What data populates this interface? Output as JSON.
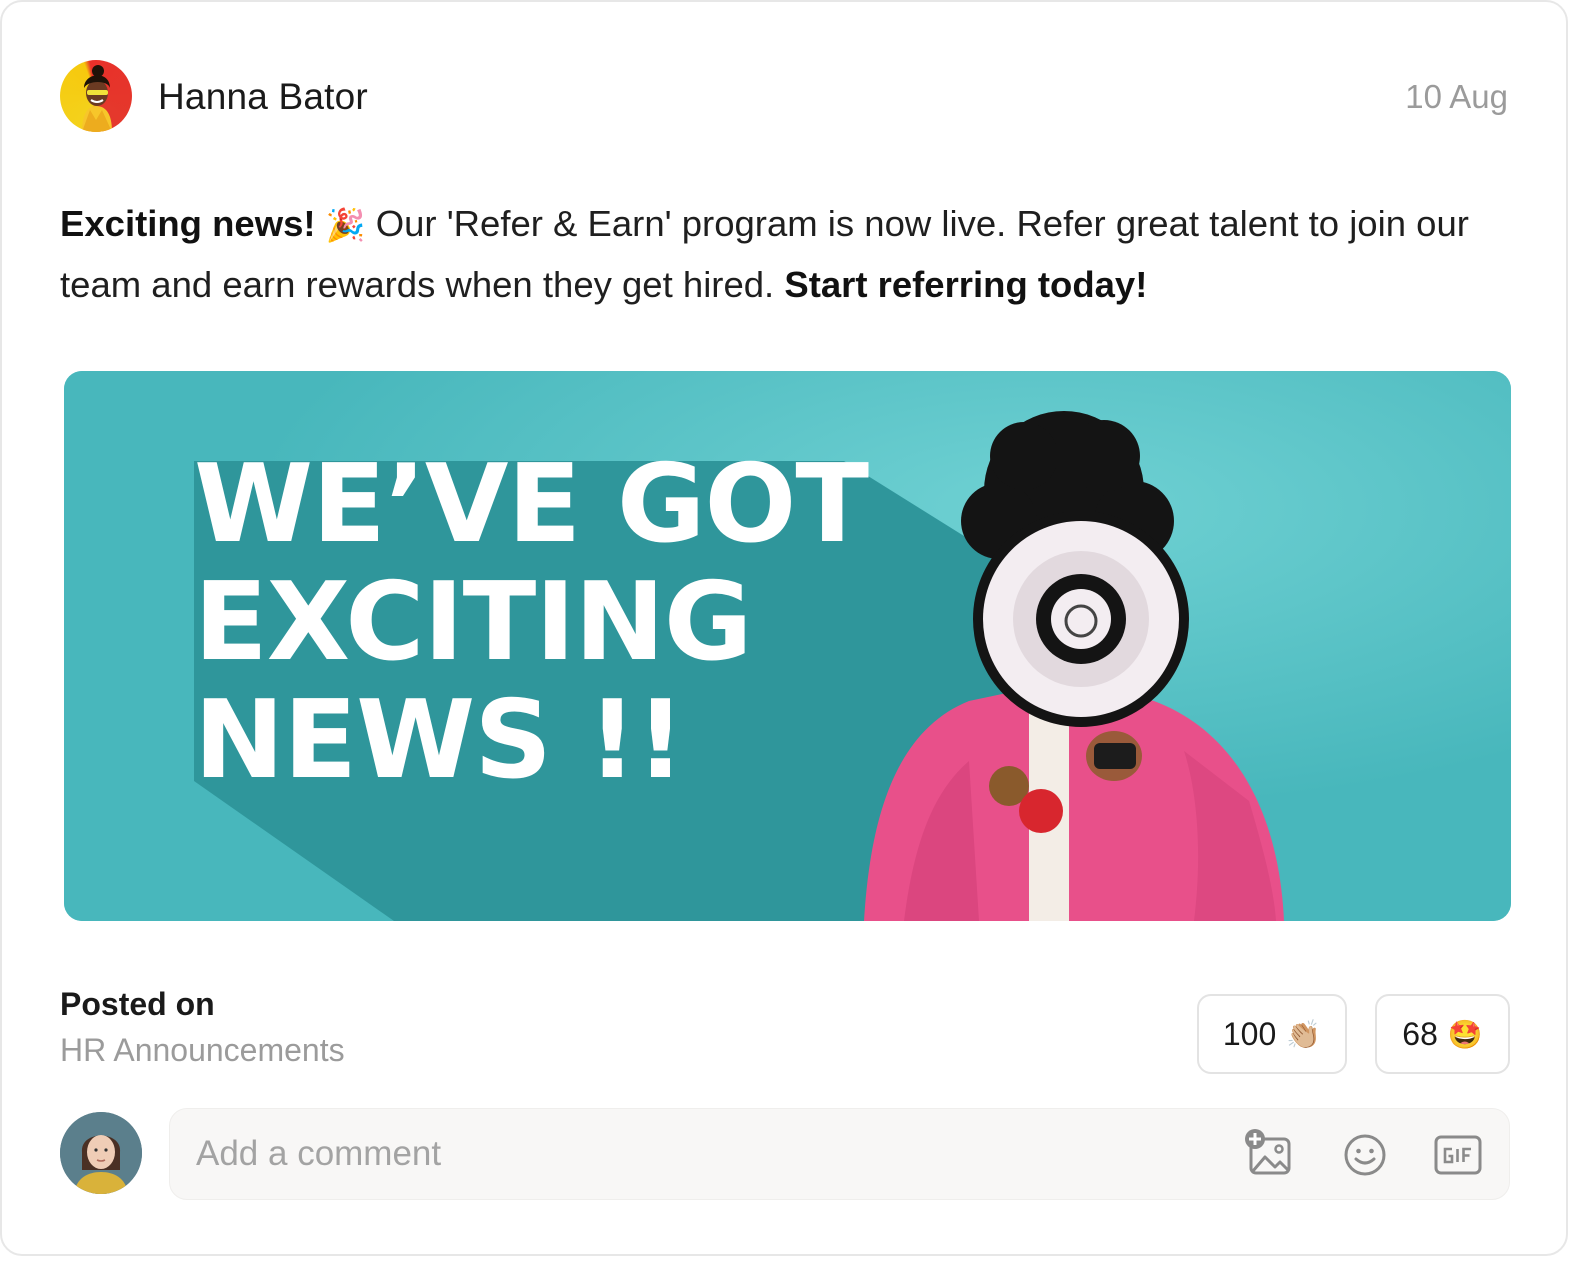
{
  "post": {
    "author": "Hanna Bator",
    "date": "10 Aug",
    "text": {
      "lead_bold": "Exciting news!",
      "emoji": "🎉",
      "body": " Our 'Refer & Earn' program is now live. Refer great talent to join our team and earn rewards when they get hired. ",
      "cta_bold": "Start referring today!"
    },
    "banner": {
      "line1": "WE’VE GOT",
      "line2": "EXCITING",
      "line3": "NEWS !!",
      "colors": {
        "background": "#52bfc3",
        "shadow": "#2f969b",
        "coat": "#e8508a"
      }
    }
  },
  "footer": {
    "posted_on_label": "Posted on",
    "channel": "HR Announcements",
    "reactions": [
      {
        "count": "100",
        "emoji": "👏🏼",
        "icon": "clapping-hands-icon"
      },
      {
        "count": "68",
        "emoji": "🤩",
        "icon": "star-struck-icon"
      }
    ]
  },
  "comment": {
    "placeholder": "Add a comment",
    "tools": [
      "add-image-icon",
      "emoji-icon",
      "gif-icon"
    ]
  }
}
